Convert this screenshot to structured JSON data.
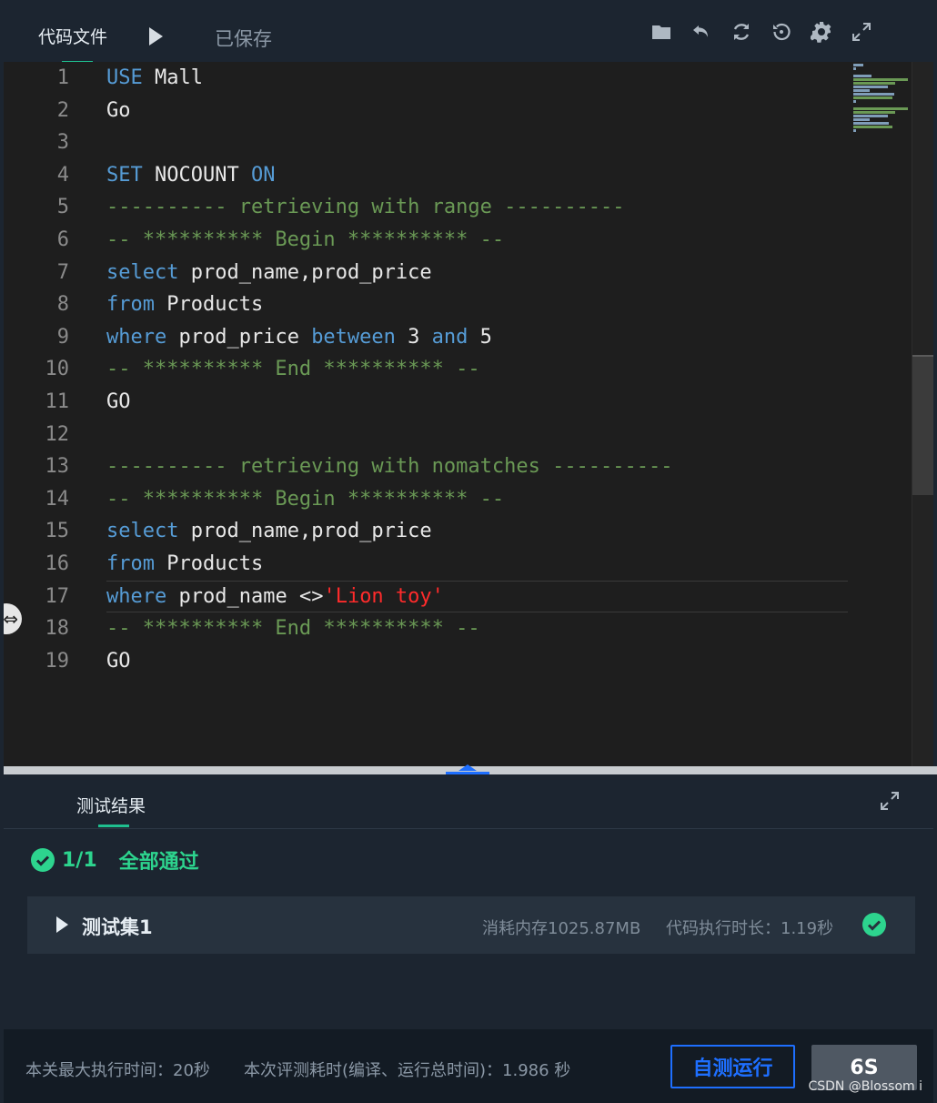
{
  "topbar": {
    "file_tab": "代码文件",
    "status": "已保存",
    "tools": [
      "folder-icon",
      "undo-icon",
      "refresh-icon",
      "history-icon",
      "gear-icon",
      "expand-icon"
    ]
  },
  "editor": {
    "line_numbers": [
      "1",
      "2",
      "3",
      "4",
      "5",
      "6",
      "7",
      "8",
      "9",
      "10",
      "11",
      "12",
      "13",
      "14",
      "15",
      "16",
      "17",
      "18",
      "19"
    ],
    "lines": [
      "USE Mall",
      "Go",
      "",
      "SET NOCOUNT ON",
      "---------- retrieving with range ----------",
      "-- ********** Begin ********** --",
      "select prod_name,prod_price",
      "from Products",
      "where prod_price between 3 and 5",
      "-- ********** End ********** --",
      "GO",
      "",
      "---------- retrieving with nomatches ----------",
      "-- ********** Begin ********** --",
      "select prod_name,prod_price",
      "from Products",
      "where prod_name <>'Lion toy'",
      "-- ********** End ********** --",
      "GO"
    ],
    "colors": {
      "keyword": "#569cd6",
      "comment": "#6a9955",
      "string": "#ff2b2b",
      "text": "#e8e8e8"
    }
  },
  "results": {
    "tab": "测试结果",
    "pass_count": "1/1",
    "pass_label": "全部通过",
    "testset": {
      "name": "测试集1",
      "memory": "消耗内存1025.87MB",
      "duration": "代码执行时长：1.19秒"
    },
    "accent": "#2dd48e"
  },
  "footer": {
    "max_time": "本关最大执行时间：20秒",
    "total_time": "本次评测耗时(编译、运行总时间)：1.986 秒",
    "self_test": "自测运行",
    "submit": "6S",
    "watermark": "CSDN @Blossom i"
  }
}
